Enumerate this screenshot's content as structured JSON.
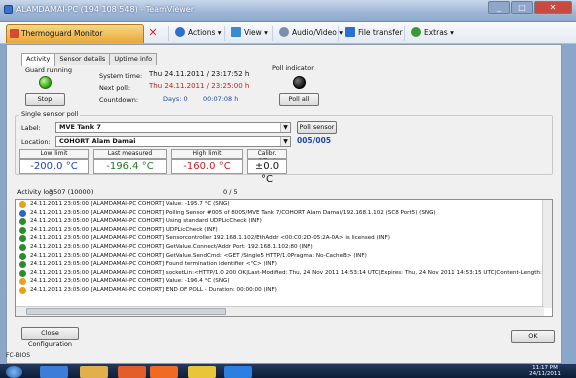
{
  "window": {
    "title": "ALAMDAMAI-PC (194 108 548) - TeamViewer",
    "controls": [
      "_",
      "□",
      "✕"
    ]
  },
  "toolbar": {
    "app_tab": "Thermoguard Monitor",
    "close": "✕",
    "items": [
      "Actions ▾",
      "View ▾",
      "Audio/Video ▾",
      "File transfer",
      "Extras ▾"
    ],
    "colors": [
      "#2f6fc9",
      "#3a8ad3",
      "#7a8fa8",
      "#2b6fd1",
      "#3b9a3a"
    ]
  },
  "app": {
    "tabs": [
      "Activity",
      "Sensor details",
      "Uptime info"
    ],
    "guard_label": "Guard running",
    "stop_label": "Stop",
    "system_time_label": "System time:",
    "system_time": "Thu 24.11.2011 / 23:17:52 h",
    "next_poll_label": "Next poll:",
    "next_poll": "Thu 24.11.2011 / 23:25:00 h",
    "countdown_label": "Countdown:",
    "countdown_days": "Days: 0",
    "countdown_time": "00:07:08 h",
    "poll_indicator_label": "Poll indicator",
    "poll_all_label": "Poll all",
    "single_sensor_title": "Single sensor poll",
    "label_label": "Label:",
    "label_value": "MVE Tank 7",
    "poll_sensor_label": "Poll sensor",
    "location_label": "Location:",
    "location_value": "COHORT Alam Damai",
    "sensor_count": "005/005",
    "headers": [
      "Low limit",
      "Last measured",
      "High limit",
      "Calibr. Offset"
    ],
    "low_limit": "-200.0 °C",
    "last_measured": "-196.4 °C",
    "high_limit": "-160.0 °C",
    "offset": "±0.0 °C",
    "activity_log_label": "Activity log",
    "activity_log_count": "3507 (10000)",
    "log_page": "0 / 5",
    "close_config_label": "Close Configuration",
    "ok_label": "OK",
    "footer": "FC-BIOS",
    "log": [
      "24.11.2011 23:05:00 [ALAMDAMAI-PC COHORT] Value: -195.7 °C (SNG)",
      "24.11.2011 23:05:00 [ALAMDAMAI-PC COHORT] Polling Sensor #005 of 8005/MVE Tank 7/COHORT Alam Damai/192.168.1.102 (SC8 Port5) (SNG)",
      "24.11.2011 23:05:00 [ALAMDAMAI-PC COHORT] Using standard UDPLicCheck (INF)",
      "24.11.2011 23:05:00 [ALAMDAMAI-PC COHORT] UDPLicCheck (INF)",
      "24.11.2011 23:05:00 [ALAMDAMAI-PC COHORT] Sensorcontroller 192.168.1.102/EthAddr <00:C0:2D-05:2A-0A> is licensed (INF)",
      "24.11.2011 23:05:00 [ALAMDAMAI-PC COHORT] GetValue.Connect/Addr Port: 192.168.1.102:80 (INF)",
      "24.11.2011 23:05:00 [ALAMDAMAI-PC COHORT] GetValue.SendCmd: <GET /Single5 HTTP/1.0Pragma: No-CacheB> (INF)",
      "24.11.2011 23:05:00 [ALAMDAMAI-PC COHORT] Found termination identifier <\"C> (INF)",
      "24.11.2011 23:05:00 [ALAMDAMAI-PC COHORT] socketLin:<HTTP/1.0 200 OK|Last-Modified: Thu, 24 Nov 2011 14:53:14 UTC|Expires: Thu, 24 Nov 2011 14:53:15 UTC|Content-Length: 8|Conte",
      "24.11.2011 23:05:00 [ALAMDAMAI-PC COHORT] Value: -196.4 °C (SNG)",
      "24.11.2011 23:05:00 [ALAMDAMAI-PC COHORT] END OF POLL - Duration: 00:00:00 (INF)"
    ],
    "log_icon_colors": [
      "#e5a21c",
      "#2c64c4",
      "#2d8b2d",
      "#2d8b2d",
      "#2d8b2d",
      "#2d8b2d",
      "#2d8b2d",
      "#2d8b2d",
      "#2d8b2d",
      "#e5a21c",
      "#e5a21c"
    ]
  },
  "taskbar": {
    "clock_time": "11:17 PM",
    "clock_date": "24/11/2011"
  }
}
